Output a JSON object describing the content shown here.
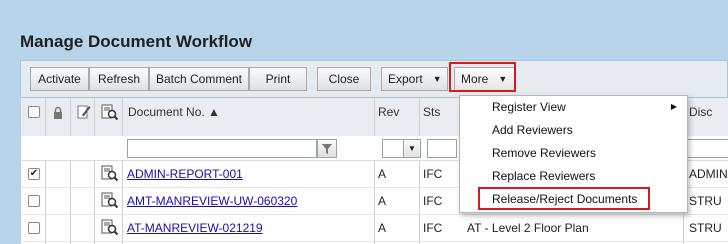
{
  "page": {
    "title": "Manage Document Workflow"
  },
  "toolbar": {
    "activate": "Activate",
    "refresh": "Refresh",
    "batch_comment": "Batch Comment",
    "print": "Print",
    "close": "Close",
    "export": "Export",
    "more": "More"
  },
  "grid": {
    "headers": {
      "document_no": "Document No. ▲",
      "rev": "Rev",
      "sts": "Sts",
      "disc": "Disc"
    },
    "rows": [
      {
        "checked": true,
        "doc_no": "ADMIN-REPORT-001",
        "rev": "A",
        "sts": "IFC",
        "title": "",
        "disc": "ADMIN"
      },
      {
        "checked": false,
        "doc_no": "AMT-MANREVIEW-UW-060320",
        "rev": "A",
        "sts": "IFC",
        "title": "",
        "disc": "STRU"
      },
      {
        "checked": false,
        "doc_no": "AT-MANREVIEW-021219",
        "rev": "A",
        "sts": "IFC",
        "title": "AT - Level 2 Floor Plan",
        "disc": "STRU"
      }
    ]
  },
  "more_menu": {
    "items": [
      {
        "label": "Register View",
        "has_submenu": true
      },
      {
        "label": "Add Reviewers",
        "has_submenu": false
      },
      {
        "label": "Remove Reviewers",
        "has_submenu": false
      },
      {
        "label": "Replace Reviewers",
        "has_submenu": false
      },
      {
        "label": "Release/Reject Documents",
        "has_submenu": false
      }
    ]
  },
  "colors": {
    "background": "#b8d4ea",
    "highlight": "#d31b1b",
    "link": "#1a0dab"
  },
  "icons": {
    "lock_col": "lock-icon",
    "edit_col": "edit-icon",
    "view_col": "document-view-icon",
    "filter": "filter-funnel-icon"
  }
}
